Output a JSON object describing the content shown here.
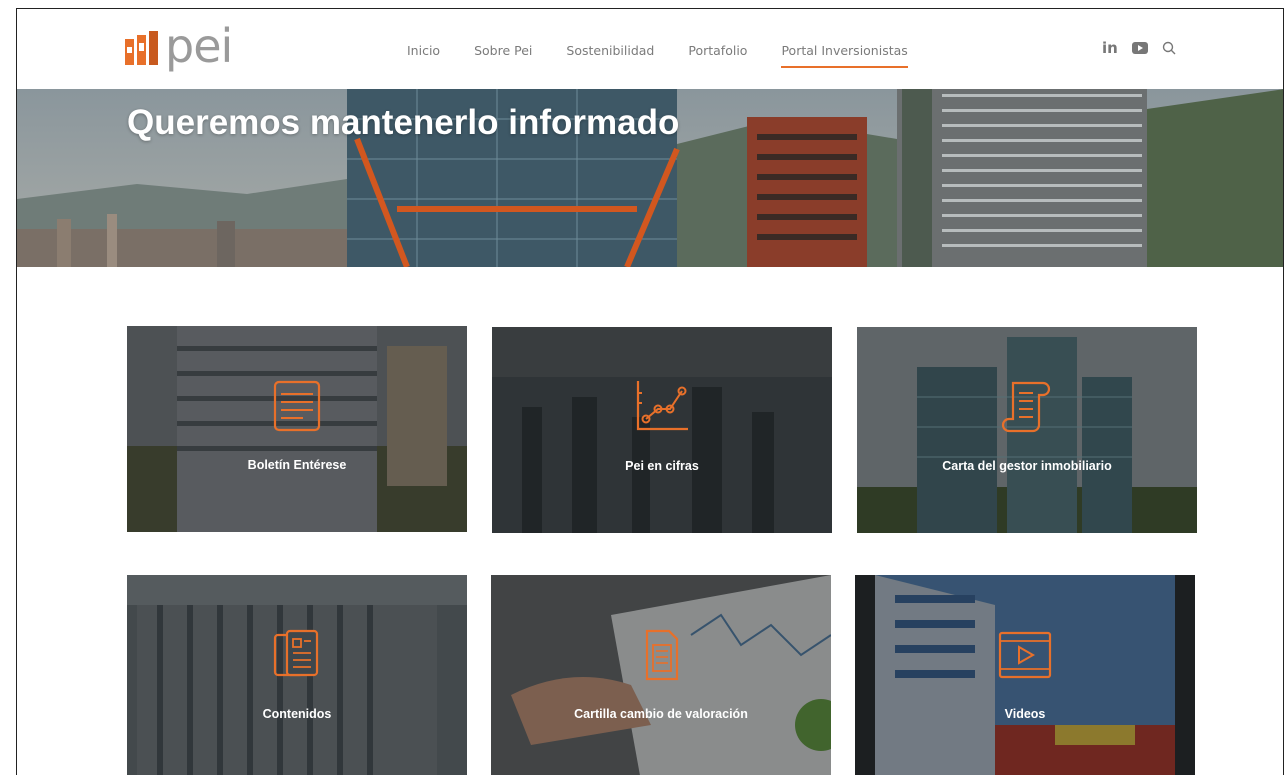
{
  "brand": {
    "logo_text": "pei",
    "accent": "#e8702a"
  },
  "nav": {
    "items": [
      {
        "label": "Inicio"
      },
      {
        "label": "Sobre Pei"
      },
      {
        "label": "Sostenibilidad"
      },
      {
        "label": "Portafolio"
      },
      {
        "label": "Portal Inversionistas",
        "active": true
      }
    ]
  },
  "header_icons": {
    "linkedin": "in",
    "youtube": "youtube-icon",
    "search": "search-icon"
  },
  "hero": {
    "title": "Queremos mantenerlo informado"
  },
  "cards": [
    {
      "label": "Boletín Entérese",
      "icon": "newsletter-icon"
    },
    {
      "label": "Pei en cifras",
      "icon": "chart-icon"
    },
    {
      "label": "Carta del gestor inmobiliario",
      "icon": "scroll-letter-icon"
    },
    {
      "label": "Contenidos",
      "icon": "documents-icon"
    },
    {
      "label": "Cartilla cambio de valoración",
      "icon": "booklet-icon"
    },
    {
      "label": "Videos",
      "icon": "video-icon"
    }
  ]
}
